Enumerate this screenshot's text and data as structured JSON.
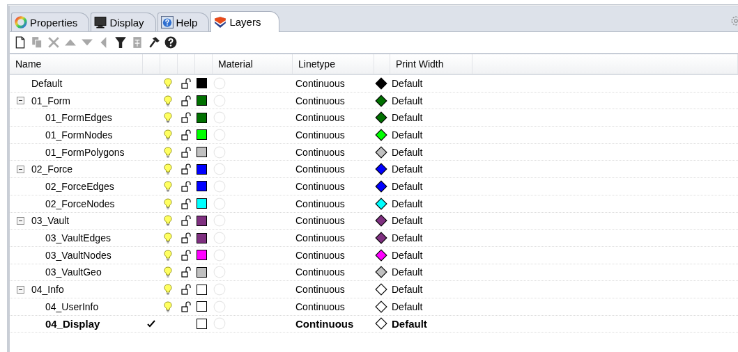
{
  "tabs": [
    {
      "label": "Properties",
      "kind": "properties",
      "selected": false
    },
    {
      "label": "Display",
      "kind": "display",
      "selected": false
    },
    {
      "label": "Help",
      "kind": "help",
      "selected": false
    },
    {
      "label": "Layers",
      "kind": "layers",
      "selected": true
    }
  ],
  "toolbar": [
    {
      "kind": "new",
      "disabled": false
    },
    {
      "kind": "copy",
      "disabled": true
    },
    {
      "kind": "delete",
      "disabled": true
    },
    {
      "kind": "up",
      "disabled": true
    },
    {
      "kind": "down",
      "disabled": true
    },
    {
      "kind": "left",
      "disabled": true
    },
    {
      "kind": "filter",
      "disabled": false
    },
    {
      "kind": "sheet",
      "disabled": true
    },
    {
      "kind": "tools",
      "disabled": false
    },
    {
      "kind": "help",
      "disabled": false
    }
  ],
  "columns": {
    "name": "Name",
    "material": "Material",
    "linetype": "Linetype",
    "print_width": "Print Width"
  },
  "layers": [
    {
      "name": "Default",
      "current": false,
      "color": "#000000",
      "linetype": "Continuous",
      "print_width": "Default"
    },
    {
      "name": "01_Form",
      "current": false,
      "expanded": true,
      "color": "#007000",
      "linetype": "Continuous",
      "print_width": "Default",
      "children": [
        {
          "name": "01_FormEdges",
          "current": false,
          "color": "#007000",
          "linetype": "Continuous",
          "print_width": "Default"
        },
        {
          "name": "01_FormNodes",
          "current": false,
          "color": "#00ff00",
          "linetype": "Continuous",
          "print_width": "Default"
        },
        {
          "name": "01_FormPolygons",
          "current": false,
          "color": "#c0c0c0",
          "linetype": "Continuous",
          "print_width": "Default"
        }
      ]
    },
    {
      "name": "02_Force",
      "current": false,
      "expanded": true,
      "color": "#0000ff",
      "linetype": "Continuous",
      "print_width": "Default",
      "children": [
        {
          "name": "02_ForceEdges",
          "current": false,
          "color": "#0000ff",
          "linetype": "Continuous",
          "print_width": "Default"
        },
        {
          "name": "02_ForceNodes",
          "current": false,
          "color": "#00ffff",
          "linetype": "Continuous",
          "print_width": "Default"
        }
      ]
    },
    {
      "name": "03_Vault",
      "current": false,
      "expanded": true,
      "color": "#7f3080",
      "linetype": "Continuous",
      "print_width": "Default",
      "children": [
        {
          "name": "03_VaultEdges",
          "current": false,
          "color": "#7f3080",
          "linetype": "Continuous",
          "print_width": "Default"
        },
        {
          "name": "03_VaultNodes",
          "current": false,
          "color": "#ff00ff",
          "linetype": "Continuous",
          "print_width": "Default"
        },
        {
          "name": "03_VaultGeo",
          "current": false,
          "color": "#c0c0c0",
          "linetype": "Continuous",
          "print_width": "Default"
        }
      ]
    },
    {
      "name": "04_Info",
      "current": false,
      "expanded": true,
      "color": "#ffffff",
      "linetype": "Continuous",
      "print_width": "Default",
      "children": [
        {
          "name": "04_UserInfo",
          "current": false,
          "color": "#ffffff",
          "linetype": "Continuous",
          "print_width": "Default"
        },
        {
          "name": "04_Display",
          "current": true,
          "color": "#ffffff",
          "linetype": "Continuous",
          "print_width": "Default"
        }
      ]
    }
  ]
}
